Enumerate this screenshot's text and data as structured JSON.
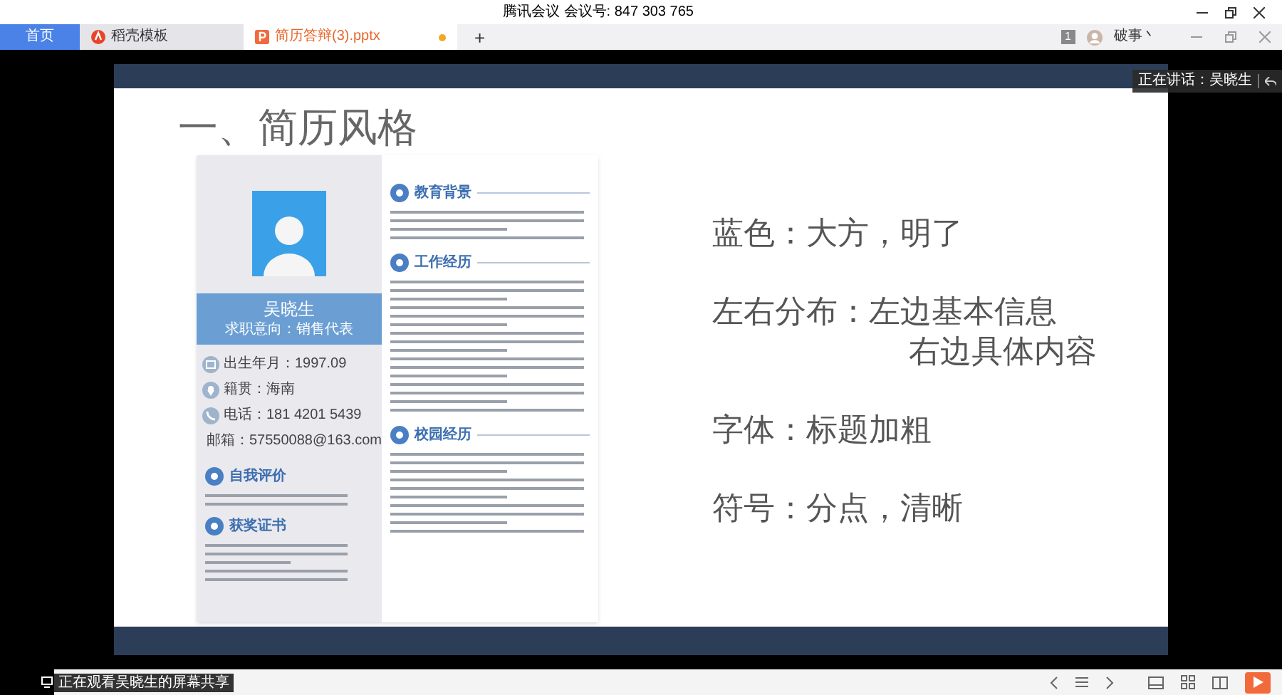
{
  "window": {
    "title": "腾讯会议 会议号: 847 303 765"
  },
  "tabs": [
    {
      "label": "首页",
      "selected": false,
      "kind": "home"
    },
    {
      "label": "稻壳模板",
      "selected": false,
      "kind": "template"
    },
    {
      "label": "简历答辩(3).pptx",
      "selected": true,
      "kind": "file"
    }
  ],
  "add_tab": "+",
  "user": {
    "badge": "1",
    "name": "破事丶"
  },
  "speaker_notice": "正在讲话：吴晓生",
  "slide": {
    "title": "一、简历风格",
    "points": [
      {
        "text": "蓝色：大方，明了",
        "kind": "line"
      },
      {
        "text": "左右分布：左边基本信息",
        "kind": "line"
      },
      {
        "text": "右边具体内容",
        "kind": "continuation"
      },
      {
        "text": "字体：标题加粗",
        "kind": "line"
      },
      {
        "text": "符号：分点，清晰",
        "kind": "line"
      }
    ],
    "resume": {
      "name": "吴晓生",
      "intent": "求职意向：销售代表",
      "info": [
        {
          "label": "出生年月：1997.09",
          "kind": "birth"
        },
        {
          "label": "籍贯：海南",
          "kind": "place"
        },
        {
          "label": "电话：181 4201 5439",
          "kind": "phone"
        },
        {
          "label": "邮箱：57550088@163.com",
          "kind": "mail"
        }
      ],
      "left_sections": [
        {
          "title": "自我评价"
        },
        {
          "title": "获奖证书"
        }
      ],
      "right_sections": [
        {
          "title": "教育背景"
        },
        {
          "title": "工作经历"
        },
        {
          "title": "校园经历"
        }
      ]
    }
  },
  "status_bar": {
    "share_notice": "正在观看吴晓生的屏幕共享"
  }
}
